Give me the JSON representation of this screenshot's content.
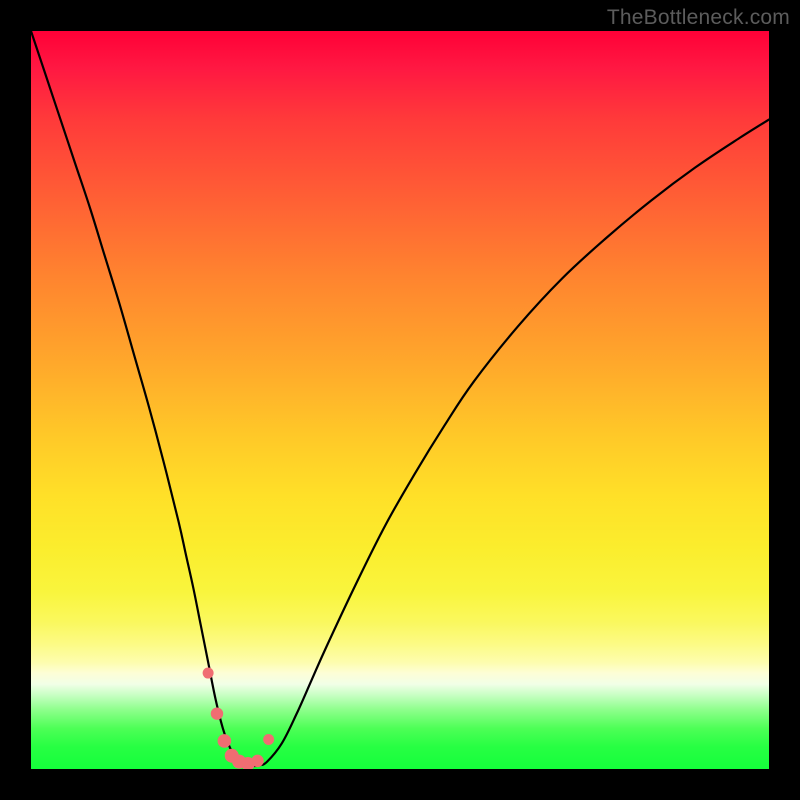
{
  "watermark": "TheBottleneck.com",
  "colors": {
    "frame": "#000000",
    "curve": "#000000",
    "marker_fill": "#f06d72",
    "marker_stroke": "#ef5d63"
  },
  "chart_data": {
    "type": "line",
    "title": "",
    "xlabel": "",
    "ylabel": "",
    "xlim": [
      0,
      100
    ],
    "ylim": [
      0,
      100
    ],
    "series": [
      {
        "name": "bottleneck-curve",
        "x": [
          0,
          2,
          4,
          6,
          8,
          10,
          12,
          14,
          16,
          18,
          20,
          21,
          22,
          23,
          24,
          25,
          26,
          27,
          28,
          29,
          30,
          31,
          32,
          34,
          36,
          38,
          40,
          44,
          48,
          52,
          56,
          60,
          66,
          72,
          78,
          84,
          90,
          96,
          100
        ],
        "y": [
          100,
          94,
          88,
          82,
          76,
          69.5,
          63,
          56,
          49,
          41.5,
          33.5,
          29,
          24.5,
          19.5,
          14.5,
          9.5,
          5.5,
          2.8,
          1.3,
          0.6,
          0.4,
          0.5,
          1.0,
          3.5,
          7.5,
          12,
          16.5,
          25,
          33,
          40,
          46.5,
          52.5,
          60,
          66.5,
          72,
          77,
          81.5,
          85.5,
          88
        ]
      }
    ],
    "markers": {
      "name": "valley-points",
      "x": [
        24.0,
        25.2,
        26.2,
        27.2,
        28.2,
        29.4,
        30.7,
        32.2
      ],
      "y": [
        13.0,
        7.5,
        3.8,
        1.8,
        1.0,
        0.7,
        1.1,
        4.0
      ],
      "r": [
        5.5,
        6.2,
        6.8,
        7.0,
        7.0,
        6.8,
        6.2,
        5.5
      ]
    }
  }
}
